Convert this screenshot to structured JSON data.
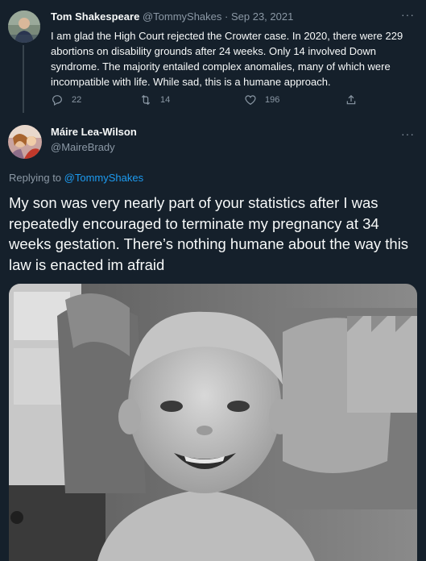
{
  "parent_tweet": {
    "author_name": "Tom Shakespeare",
    "handle": "@TommyShakes",
    "separator": "·",
    "date": "Sep 23, 2021",
    "text": "I am glad the High Court rejected the Crowter case. In 2020, there were 229 abortions on disability grounds after 24 weeks. Only 14 involved Down syndrome. The majority entailed complex anomalies, many of which were incompatible with life. While sad, this is a humane approach.",
    "more_label": "···",
    "actions": {
      "reply_count": "22",
      "retweet_count": "14",
      "like_count": "196"
    }
  },
  "main_tweet": {
    "author_name": "Máire Lea-Wilson",
    "handle": "@MaireBrady",
    "more_label": "···",
    "replying_prefix": "Replying to",
    "replying_to": "@TommyShakes",
    "text": "My son was very nearly part of your statistics after I was repeatedly encouraged to terminate my pregnancy at 34 weeks gestation. There’s nothing humane about the way this law is enacted im afraid"
  },
  "colors": {
    "background": "#15202b",
    "text": "#f7f9f9",
    "muted": "#8b98a5",
    "link": "#1d9bf0",
    "divider": "#38444d"
  },
  "icons": {
    "reply": "reply-icon",
    "retweet": "retweet-icon",
    "like": "heart-icon",
    "share": "share-icon",
    "more": "more-icon"
  }
}
